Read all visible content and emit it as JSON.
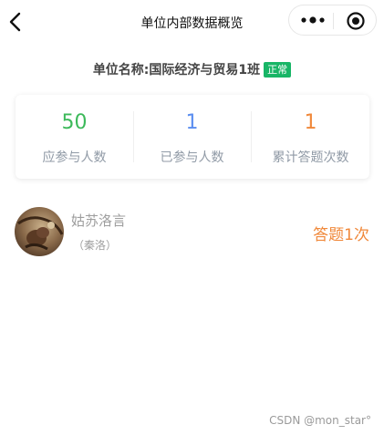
{
  "navbar": {
    "title": "单位内部数据概览"
  },
  "unit": {
    "label": "单位名称:",
    "name": "国际经济与贸易1班",
    "status": "正常"
  },
  "stats": [
    {
      "value": "50",
      "label": "应参与人数",
      "color": "#3cb95a"
    },
    {
      "value": "1",
      "label": "已参与人数",
      "color": "#5b8ef0"
    },
    {
      "value": "1",
      "label": "累计答题次数",
      "color": "#f0883a"
    }
  ],
  "participants": [
    {
      "name": "姑苏洛言",
      "alias": "（秦洛）",
      "count_text": "答题1次"
    }
  ],
  "watermark": "CSDN @mon_star°"
}
